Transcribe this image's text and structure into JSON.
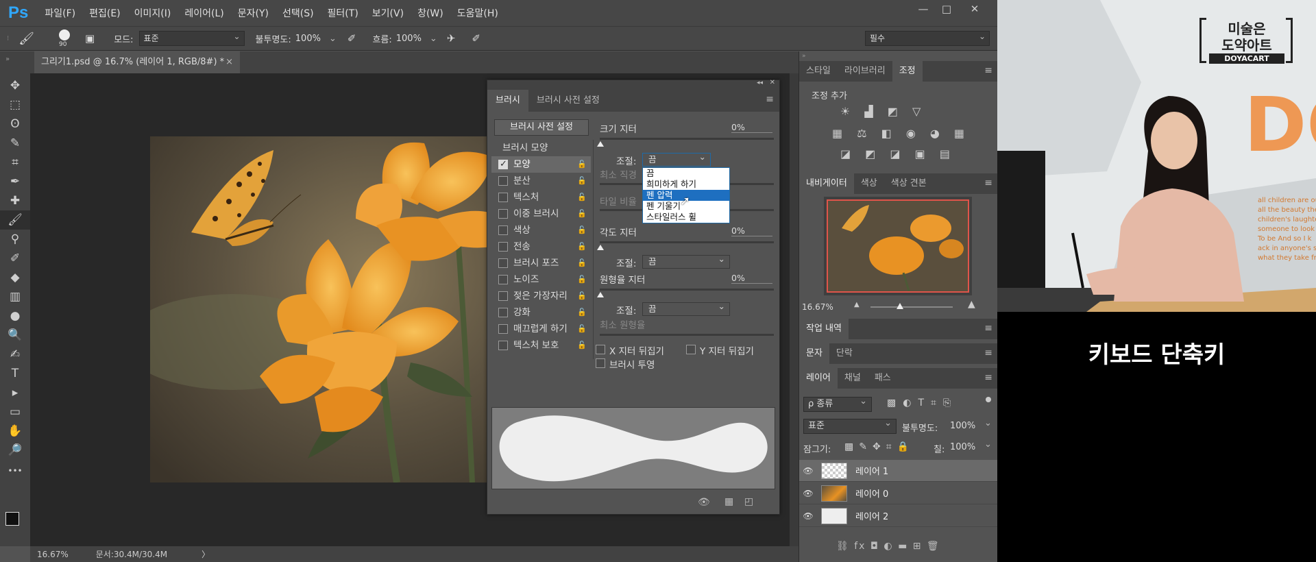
{
  "app": {
    "logo": "Ps",
    "menu": [
      "파일(F)",
      "편집(E)",
      "이미지(I)",
      "레이어(L)",
      "문자(Y)",
      "선택(S)",
      "필터(T)",
      "보기(V)",
      "창(W)",
      "도움말(H)"
    ],
    "window_controls": [
      "—",
      "□",
      "✕"
    ]
  },
  "options_bar": {
    "brush_size": "90",
    "mode_label": "모드:",
    "mode_value": "표준",
    "opacity_label": "불투명도:",
    "opacity_value": "100%",
    "flow_label": "흐름:",
    "flow_value": "100%",
    "workspace": "필수"
  },
  "document": {
    "tab_title": "그리기1.psd @ 16.7% (레이어 1, RGB/8#) *",
    "tab_close": "×"
  },
  "status": {
    "zoom": "16.67%",
    "doc_size": "문서:30.4M/30.4M",
    "arrow": "〉"
  },
  "tools": [
    "✥",
    "⬚",
    "ʘ",
    "✎",
    "⌗",
    "✒",
    "✚",
    "🖌",
    "⚲",
    "✐",
    "◆",
    "▥",
    "●",
    "🔍",
    "✍",
    "T",
    "▸",
    "▭",
    "✋",
    "🔎",
    "•••"
  ],
  "brush_panel": {
    "tabs": [
      "브러시",
      "브러시 사전 설정"
    ],
    "presets_button": "브러시 사전 설정",
    "list": [
      {
        "label": "브러시 모양",
        "checked": null
      },
      {
        "label": "모양",
        "checked": true
      },
      {
        "label": "분산",
        "checked": false
      },
      {
        "label": "텍스처",
        "checked": false
      },
      {
        "label": "이중 브러시",
        "checked": false
      },
      {
        "label": "색상",
        "checked": false
      },
      {
        "label": "전송",
        "checked": false
      },
      {
        "label": "브러시 포즈",
        "checked": false
      },
      {
        "label": "노이즈",
        "checked": false
      },
      {
        "label": "젖은 가장자리",
        "checked": false
      },
      {
        "label": "강화",
        "checked": false
      },
      {
        "label": "매끄럽게 하기",
        "checked": false
      },
      {
        "label": "텍스처 보호",
        "checked": false
      }
    ],
    "size_jitter_label": "크기 지터",
    "size_jitter_value": "0%",
    "control_label": "조절:",
    "control_value": "끔",
    "min_diameter_label": "최소 직경",
    "tilt_scale_label": "타일 비율",
    "angle_jitter_label": "각도 지터",
    "angle_jitter_value": "0%",
    "angle_control_value": "끔",
    "roundness_jitter_label": "원형율 지터",
    "roundness_jitter_value": "0%",
    "roundness_control_value": "끔",
    "min_roundness_label": "최소 원형율",
    "flip_x_label": "X 지터 뒤집기",
    "flip_y_label": "Y 지터 뒤집기",
    "brush_projection_label": "브러시 투영",
    "dropdown_options": [
      "끔",
      "희미하게 하기",
      "펜 압력",
      "펜 기울기",
      "스타일러스 휠"
    ],
    "dropdown_selected": "펜 압력"
  },
  "right_panels": {
    "top_tabs": [
      "스타일",
      "라이브러리",
      "조정"
    ],
    "adjust_title": "조정 추가",
    "adjust_row1": "☀ ▟ ◩ ▽",
    "adjust_row2": "▦ ⚖ ◧ ◉ ◕ ▦",
    "adjust_row3": "◪ ◩ ◪ ▣ ▤",
    "nav_tabs": [
      "내비게이터",
      "색상",
      "색상 견본"
    ],
    "nav_zoom": "16.67%",
    "history_tab": "작업 내역",
    "char_tabs": [
      "문자",
      "단락"
    ],
    "layers_tabs": [
      "레이어",
      "채널",
      "패스"
    ],
    "kind_filter": "ρ 종류",
    "blend_mode": "표준",
    "opacity_label": "불투명도:",
    "opacity_value": "100%",
    "lock_label": "잠그기:",
    "fill_label": "칠:",
    "fill_value": "100%",
    "layers": [
      {
        "name": "레이어 1",
        "active": true
      },
      {
        "name": "레이어 0",
        "active": false
      },
      {
        "name": "레이어 2",
        "active": false
      }
    ],
    "footer_icons": "⛓  fx  ◘  ◐  ▬  ⊞  🗑"
  },
  "video": {
    "logo_line1": "미술은",
    "logo_line2": "도약아트",
    "logo_brand": "DOYACART",
    "caption": "키보드 단축키",
    "bg_letters": "DO",
    "wall_text": [
      "all children are our fut",
      "all the beauty they",
      "children's laughter rem",
      "someone to look",
      "To be And so I k",
      "ack in anyone's shad",
      "what they take from"
    ]
  },
  "colors": {
    "ps_bg": "#535353",
    "bar": "#474747",
    "accent": "#1e6fc0",
    "nav_frame": "#e0544a"
  }
}
